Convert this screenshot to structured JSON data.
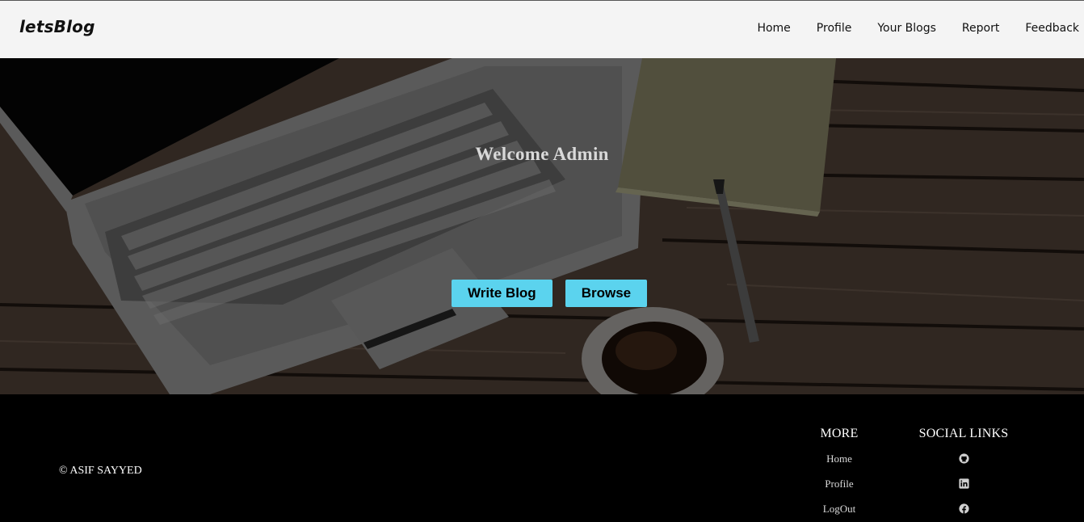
{
  "navbar": {
    "brand": "letsBlog",
    "links": [
      "Home",
      "Profile",
      "Your Blogs",
      "Report",
      "Feedback"
    ]
  },
  "hero": {
    "title": "Welcome Admin",
    "buttons": {
      "write": "Write Blog",
      "browse": "Browse"
    },
    "button_color": "#5bd3ee"
  },
  "footer": {
    "copyright": "© ASIF SAYYED",
    "more": {
      "heading": "MORE",
      "links": [
        "Home",
        "Profile",
        "LogOut"
      ]
    },
    "social": {
      "heading": "SOCIAL LINKS",
      "icons": [
        "github-icon",
        "linkedin-icon",
        "facebook-icon"
      ]
    }
  }
}
